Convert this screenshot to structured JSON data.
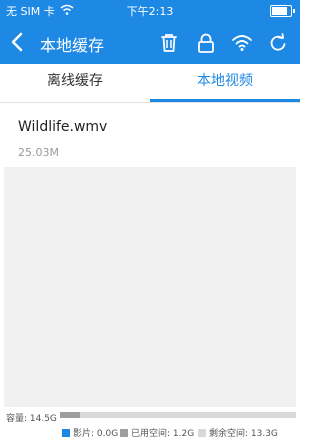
{
  "status_bar": {
    "carrier": "无 SIM 卡",
    "time": "下午2:13"
  },
  "navbar": {
    "title": "本地缓存"
  },
  "tabs": [
    {
      "label": "离线缓存",
      "active": false
    },
    {
      "label": "本地视频",
      "active": true
    }
  ],
  "files": [
    {
      "name": "Wildlife.wmv",
      "size": "25.03M"
    }
  ],
  "storage": {
    "label": "容量: 14.5G",
    "legend": [
      {
        "label": "影片: 0.0G",
        "color": "#1e88e5"
      },
      {
        "label": "已用空间: 1.2G",
        "color": "#9e9e9e"
      },
      {
        "label": "剩余空间: 13.3G",
        "color": "#d9d9d9"
      }
    ]
  },
  "colors": {
    "primary": "#1e88e5",
    "background": "#f1f1f1"
  }
}
